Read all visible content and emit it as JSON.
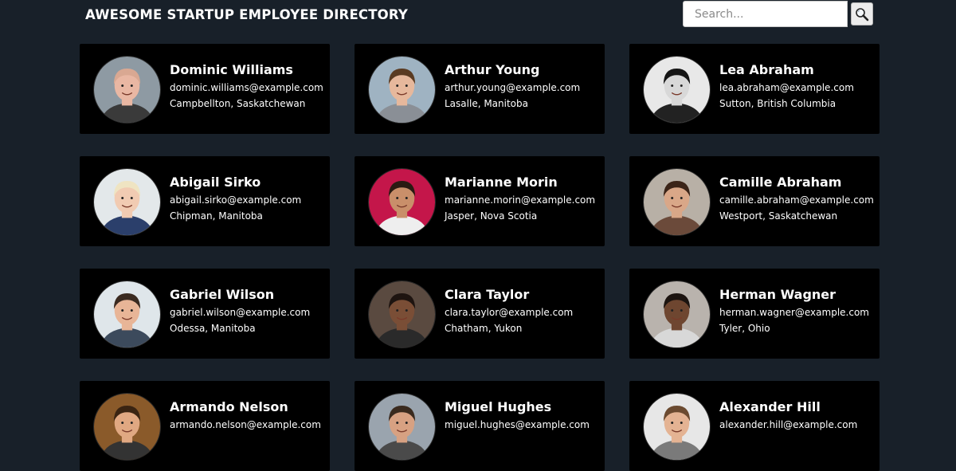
{
  "header": {
    "title": "AWESOME STARTUP EMPLOYEE DIRECTORY"
  },
  "search": {
    "placeholder": "Search...",
    "value": "",
    "button_icon": "magnifier-icon"
  },
  "employees": [
    {
      "name": "Dominic Williams",
      "email": "dominic.williams@example.com",
      "location": "Campbellton, Saskatchewan",
      "avatar_bg": "#8e9aa3",
      "avatar_skin": "#e9b7a3",
      "avatar_hair": "#d9a892",
      "avatar_shirt": "#3a3a3a"
    },
    {
      "name": "Arthur Young",
      "email": "arthur.young@example.com",
      "location": "Lasalle, Manitoba",
      "avatar_bg": "#9fb3c2",
      "avatar_skin": "#e6b89c",
      "avatar_hair": "#5a3b22",
      "avatar_shirt": "#8a8f96"
    },
    {
      "name": "Lea Abraham",
      "email": "lea.abraham@example.com",
      "location": "Sutton, British Columbia",
      "avatar_bg": "#e8e8e8",
      "avatar_skin": "#d8d8d8",
      "avatar_hair": "#151515",
      "avatar_shirt": "#222222"
    },
    {
      "name": "Abigail Sirko",
      "email": "abigail.sirko@example.com",
      "location": "Chipman, Manitoba",
      "avatar_bg": "#e3e8ea",
      "avatar_skin": "#f1cbb2",
      "avatar_hair": "#efe4c2",
      "avatar_shirt": "#2b3f6b"
    },
    {
      "name": "Marianne Morin",
      "email": "marianne.morin@example.com",
      "location": "Jasper, Nova Scotia",
      "avatar_bg": "#c4164a",
      "avatar_skin": "#c98f6a",
      "avatar_hair": "#2a1a12",
      "avatar_shirt": "#eeeeee"
    },
    {
      "name": "Camille Abraham",
      "email": "camille.abraham@example.com",
      "location": "Westport, Saskatchewan",
      "avatar_bg": "#b8b0a6",
      "avatar_skin": "#d9a788",
      "avatar_hair": "#3b2418",
      "avatar_shirt": "#6b4a3a"
    },
    {
      "name": "Gabriel Wilson",
      "email": "gabriel.wilson@example.com",
      "location": "Odessa, Manitoba",
      "avatar_bg": "#dfe6ea",
      "avatar_skin": "#e8b597",
      "avatar_hair": "#3a2a20",
      "avatar_shirt": "#3c4a5c"
    },
    {
      "name": "Clara Taylor",
      "email": "clara.taylor@example.com",
      "location": "Chatham, Yukon",
      "avatar_bg": "#5a4a40",
      "avatar_skin": "#7a4e36",
      "avatar_hair": "#1e1410",
      "avatar_shirt": "#2a2a2a"
    },
    {
      "name": "Herman Wagner",
      "email": "herman.wagner@example.com",
      "location": "Tyler, Ohio",
      "avatar_bg": "#b9b3ad",
      "avatar_skin": "#6e4630",
      "avatar_hair": "#1c1410",
      "avatar_shirt": "#d8d8d8"
    },
    {
      "name": "Armando Nelson",
      "email": "armando.nelson@example.com",
      "location": "",
      "avatar_bg": "#8a5a2a",
      "avatar_skin": "#e0a882",
      "avatar_hair": "#3a2412",
      "avatar_shirt": "#333333"
    },
    {
      "name": "Miguel Hughes",
      "email": "miguel.hughes@example.com",
      "location": "",
      "avatar_bg": "#9aa4ae",
      "avatar_skin": "#d7a182",
      "avatar_hair": "#3a2a1e",
      "avatar_shirt": "#4a4a4a"
    },
    {
      "name": "Alexander Hill",
      "email": "alexander.hill@example.com",
      "location": "",
      "avatar_bg": "#e7e7e7",
      "avatar_skin": "#e4b393",
      "avatar_hair": "#6b4a30",
      "avatar_shirt": "#7a7a7a"
    }
  ]
}
